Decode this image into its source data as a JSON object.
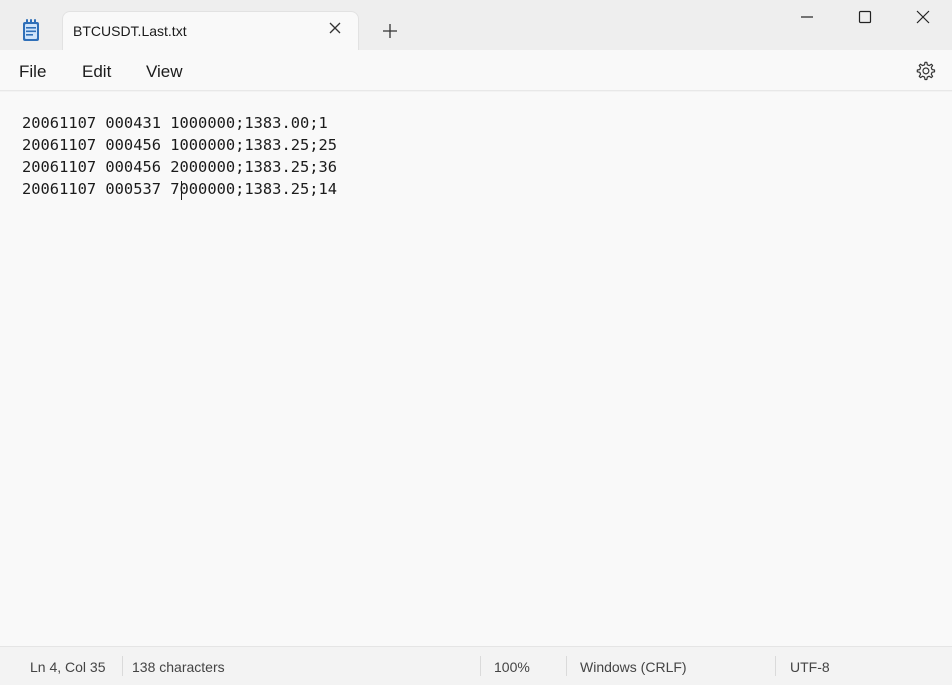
{
  "tab": {
    "title": "BTCUSDT.Last.txt"
  },
  "menu": {
    "file": "File",
    "edit": "Edit",
    "view": "View"
  },
  "editor": {
    "lines": [
      "20061107 000431 1000000;1383.00;1",
      "20061107 000456 1000000;1383.25;25",
      "20061107 000456 2000000;1383.25;36",
      "20061107 000537 7000000;1383.25;14"
    ]
  },
  "status": {
    "position": "Ln 4, Col 35",
    "characters": "138 characters",
    "zoom": "100%",
    "line_ending": "Windows (CRLF)",
    "encoding": "UTF-8"
  },
  "icons": {
    "app": "notepad-icon",
    "tab_close": "close-icon",
    "new_tab": "plus-icon",
    "minimize": "minimize-icon",
    "maximize": "maximize-icon",
    "close": "close-icon",
    "settings": "gear-icon"
  },
  "colors": {
    "accent": "#3a7bd5",
    "background": "#f9f9f9"
  }
}
